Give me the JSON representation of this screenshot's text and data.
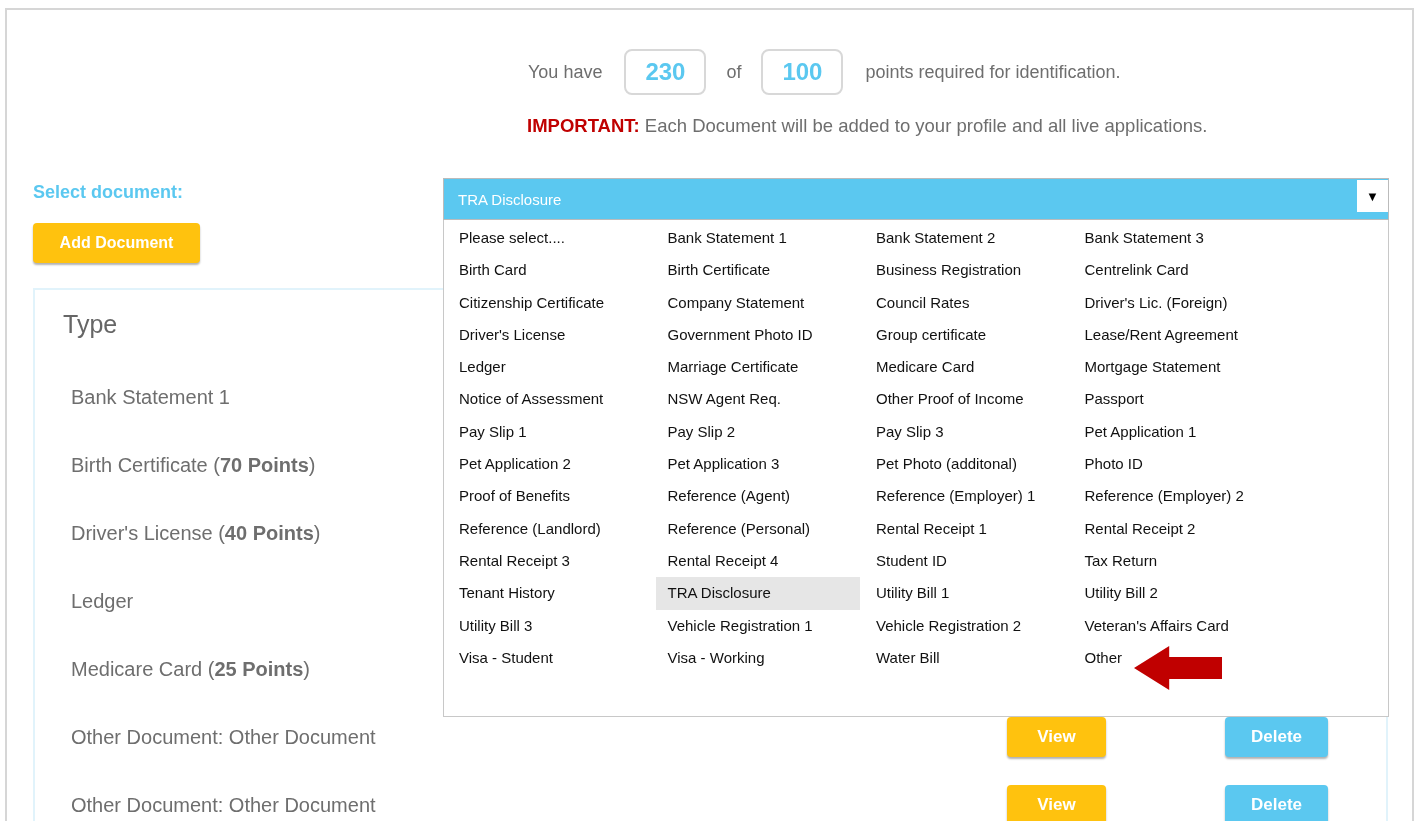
{
  "points": {
    "prefix": "You have",
    "have": "230",
    "of": "of",
    "required": "100",
    "suffix": "points required for identification."
  },
  "notice": "**IMPORTANT:** Each Document will be added to your profile and all live applications.",
  "select_label": "Select document:",
  "add_button": "Add Document",
  "dropdown": {
    "value": "TRA Disclosure",
    "expanded": true,
    "arrow": "▼",
    "options": [
      {
        "label": "Please select....",
        "selected": false
      },
      {
        "label": "Bank Statement 1",
        "selected": false
      },
      {
        "label": "Bank Statement 2",
        "selected": false
      },
      {
        "label": "Bank Statement 3",
        "selected": false
      },
      {
        "label": "Birth Card",
        "selected": false
      },
      {
        "label": "Birth Certificate",
        "selected": false
      },
      {
        "label": "Business Registration",
        "selected": false
      },
      {
        "label": "Centrelink Card",
        "selected": false
      },
      {
        "label": "Citizenship Certificate",
        "selected": false
      },
      {
        "label": "Company Statement",
        "selected": false
      },
      {
        "label": "Council Rates",
        "selected": false
      },
      {
        "label": "Driver's Lic. (Foreign)",
        "selected": false
      },
      {
        "label": "Driver's License",
        "selected": false
      },
      {
        "label": "Government Photo ID",
        "selected": false
      },
      {
        "label": "Group certificate",
        "selected": false
      },
      {
        "label": "Lease/Rent Agreement",
        "selected": false
      },
      {
        "label": "Ledger",
        "selected": false
      },
      {
        "label": "Marriage Certificate",
        "selected": false
      },
      {
        "label": "Medicare Card",
        "selected": false
      },
      {
        "label": "Mortgage Statement",
        "selected": false
      },
      {
        "label": "Notice of Assessment",
        "selected": false
      },
      {
        "label": "NSW Agent Req.",
        "selected": false
      },
      {
        "label": "Other Proof of Income",
        "selected": false
      },
      {
        "label": "Passport",
        "selected": false
      },
      {
        "label": "Pay Slip 1",
        "selected": false
      },
      {
        "label": "Pay Slip 2",
        "selected": false
      },
      {
        "label": "Pay Slip 3",
        "selected": false
      },
      {
        "label": "Pet Application 1",
        "selected": false
      },
      {
        "label": "Pet Application 2",
        "selected": false
      },
      {
        "label": "Pet Application 3",
        "selected": false
      },
      {
        "label": "Pet Photo (additonal)",
        "selected": false
      },
      {
        "label": "Photo ID",
        "selected": false
      },
      {
        "label": "Proof of Benefits",
        "selected": false
      },
      {
        "label": "Reference (Agent)",
        "selected": false
      },
      {
        "label": "Reference (Employer) 1",
        "selected": false
      },
      {
        "label": "Reference (Employer) 2",
        "selected": false
      },
      {
        "label": "Reference (Landlord)",
        "selected": false
      },
      {
        "label": "Reference (Personal)",
        "selected": false
      },
      {
        "label": "Rental Receipt 1",
        "selected": false
      },
      {
        "label": "Rental Receipt 2",
        "selected": false
      },
      {
        "label": "Rental Receipt 3",
        "selected": false
      },
      {
        "label": "Rental Receipt 4",
        "selected": false
      },
      {
        "label": "Student ID",
        "selected": false
      },
      {
        "label": "Tax Return",
        "selected": false
      },
      {
        "label": "Tenant History",
        "selected": false
      },
      {
        "label": "TRA Disclosure",
        "selected": true
      },
      {
        "label": "Utility Bill 1",
        "selected": false
      },
      {
        "label": "Utility Bill 2",
        "selected": false
      },
      {
        "label": "Utility Bill 3",
        "selected": false
      },
      {
        "label": "Vehicle Registration 1",
        "selected": false
      },
      {
        "label": "Vehicle Registration 2",
        "selected": false
      },
      {
        "label": "Veteran's Affairs Card",
        "selected": false
      },
      {
        "label": "Visa - Student",
        "selected": false
      },
      {
        "label": "Visa - Working",
        "selected": false
      },
      {
        "label": "Water Bill",
        "selected": false
      },
      {
        "label": "Other",
        "selected": false
      }
    ]
  },
  "table": {
    "heading": "Type",
    "rows": [
      {
        "type": "Bank Statement 1"
      },
      {
        "type": "Birth Certificate (**70 Points**)"
      },
      {
        "type": "Driver's License (**40 Points**)"
      },
      {
        "type": "Ledger"
      },
      {
        "type": "Medicare Card (**25 Points**)"
      },
      {
        "type": "Other Document: Other Document",
        "view": "View",
        "delete": "Delete"
      },
      {
        "type": "Other Document: Other Document",
        "view": "View",
        "delete": "Delete"
      }
    ]
  }
}
